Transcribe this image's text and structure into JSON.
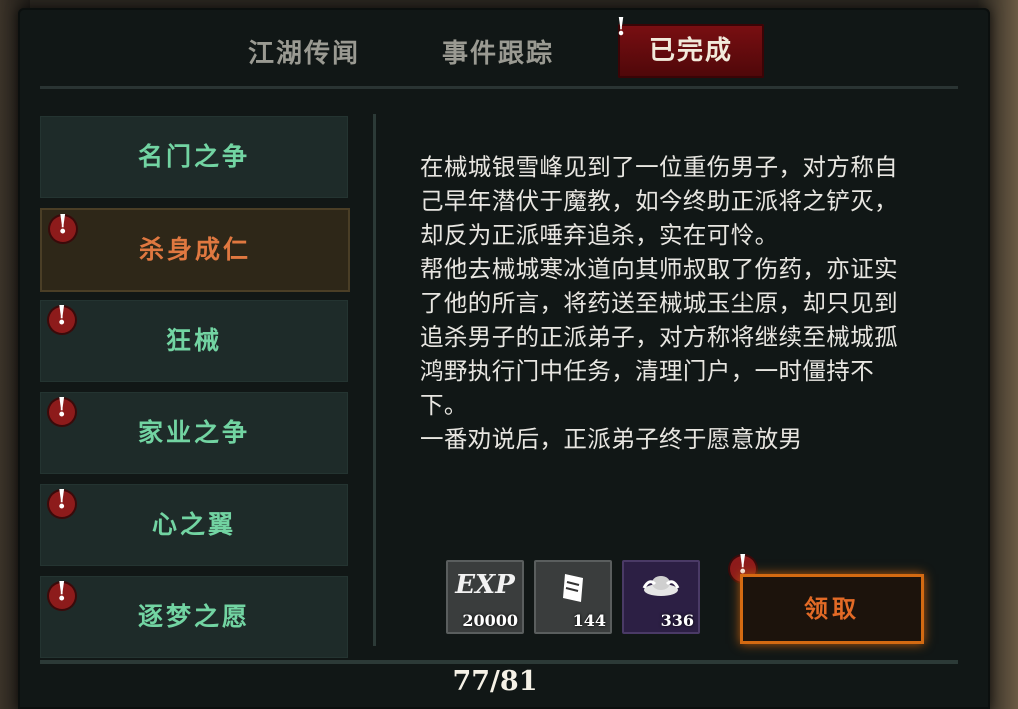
{
  "tabs": [
    {
      "label": "江湖传闻",
      "active": false
    },
    {
      "label": "事件跟踪",
      "active": false
    },
    {
      "label": "已完成",
      "active": true
    }
  ],
  "quest_list": [
    {
      "label": "名门之争",
      "alert": false,
      "selected": false
    },
    {
      "label": "杀身成仁",
      "alert": true,
      "selected": true
    },
    {
      "label": "狂械",
      "alert": true,
      "selected": false
    },
    {
      "label": "家业之争",
      "alert": true,
      "selected": false
    },
    {
      "label": "心之翼",
      "alert": true,
      "selected": false
    },
    {
      "label": "逐梦之愿",
      "alert": true,
      "selected": false
    }
  ],
  "story_text": "在械城银雪峰见到了一位重伤男子，对方称自己早年潜伏于魔教，如今终助正派将之铲灭，却反为正派唾弃追杀，实在可怜。\n帮他去械城寒冰道向其师叔取了伤药，亦证实了他的所言，将药送至械城玉尘原，却只见到追杀男子的正派弟子，对方称将继续至械城孤鸿野执行门中任务，清理门户，一时僵持不下。\n一番劝说后，正派弟子终于愿意放男",
  "rewards": [
    {
      "icon_label": "EXP",
      "amount": "20000",
      "icon": "exp-icon"
    },
    {
      "icon_label": "",
      "amount": "144",
      "icon": "ticket-icon"
    },
    {
      "icon_label": "",
      "amount": "336",
      "icon": "silver-ingot-icon"
    }
  ],
  "claim_label": "领取",
  "counter": "77/81",
  "colors": {
    "active_tab": "#7a0f12",
    "quest_text": "#72d4a2",
    "selected_text": "#e07840",
    "claim_border": "#d36a12"
  }
}
